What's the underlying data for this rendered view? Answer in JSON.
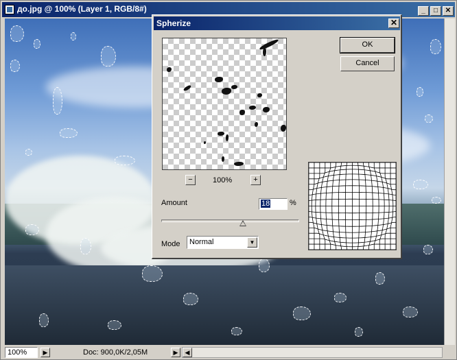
{
  "document": {
    "title": "до.jpg @ 100% (Layer 1, RGB/8#)",
    "window_controls": {
      "minimize": "_",
      "maximize": "□",
      "close": "✕"
    }
  },
  "status": {
    "zoom": "100%",
    "doc_info": "Doc: 900,0K/2,05M",
    "arrow_right": "▶",
    "arrow_left": "◀",
    "arrow_right2": "▶"
  },
  "dialog": {
    "title": "Spherize",
    "close": "✕",
    "ok_label": "OK",
    "cancel_label": "Cancel",
    "zoom_out": "−",
    "zoom_in": "+",
    "zoom_level": "100%",
    "amount_label": "Amount",
    "amount_value": "18",
    "amount_unit": "%",
    "amount_min": -100,
    "amount_max": 100,
    "mode_label": "Mode",
    "mode_value": "Normal",
    "mode_arrow": "▼"
  },
  "icons": {
    "doc_icon": "document-icon",
    "dropdown": "chevron-down-icon"
  },
  "colors": {
    "titlebar_start": "#0a246a",
    "titlebar_end": "#3a6ea5",
    "dialog_face": "#d4d0c8",
    "selection": "#0a246a"
  }
}
